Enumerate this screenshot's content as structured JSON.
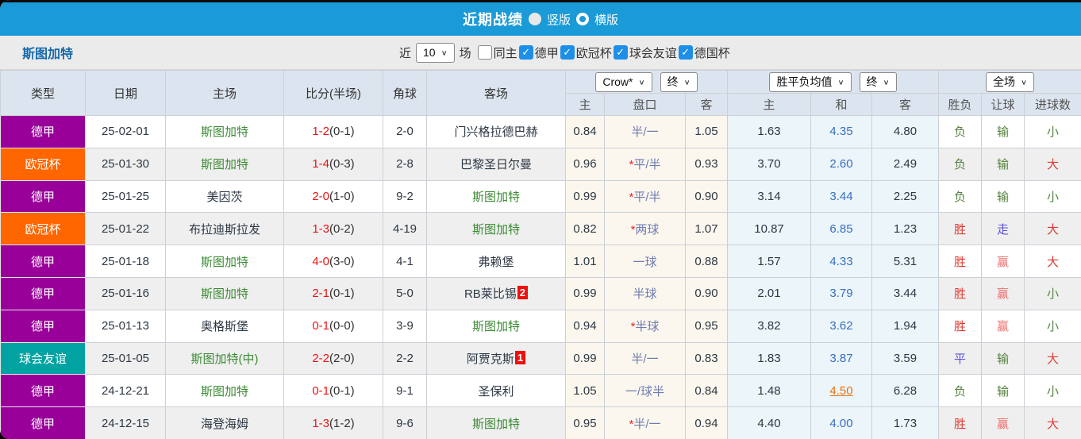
{
  "icons": {
    "chevron_down": "∨",
    "check": "✓"
  },
  "colors": {
    "topbar": "#1a9ad6",
    "league": {
      "德甲": "#990099",
      "欧冠杯": "#ff6600",
      "球会友谊": "#00a2a2"
    }
  },
  "titlebar": {
    "title": "近期战绩",
    "vertical_label": "竖版",
    "horizontal_label": "横版"
  },
  "filterbar": {
    "team": "斯图加特",
    "recent_label": "近",
    "recent_value": "10",
    "games_label": "场",
    "same_home_label": "同主",
    "same_home_checked": false,
    "league_filters": [
      {
        "label": "德甲",
        "checked": true
      },
      {
        "label": "欧冠杯",
        "checked": true
      },
      {
        "label": "球会友谊",
        "checked": true
      },
      {
        "label": "德国杯",
        "checked": true
      }
    ]
  },
  "table": {
    "static_headers": [
      "类型",
      "日期",
      "主场",
      "比分(半场)",
      "角球",
      "客场"
    ],
    "odds_source_select": "Crow*",
    "odds_final_select": "终",
    "avg_select": "胜平负均值",
    "avg_final_select": "终",
    "scope_select": "全场",
    "sub_headers": [
      "主",
      "盘口",
      "客",
      "主",
      "和",
      "客",
      "胜负",
      "让球",
      "进球数"
    ],
    "rows": [
      {
        "league": "德甲",
        "date": "25-02-01",
        "home": "斯图加特",
        "home_hl": true,
        "ft": "1-2",
        "ht": "(0-1)",
        "corners": "2-0",
        "away": "门兴格拉德巴赫",
        "away_hl": false,
        "away_badge": "",
        "odds_home": "0.84",
        "handicap_star": false,
        "handicap": "半/一",
        "odds_away": "1.05",
        "avg_home": "1.63",
        "avg_draw": "4.35",
        "avg_away": "4.80",
        "avg_draw_link": false,
        "result": "负",
        "let_result": "输",
        "goals": "小"
      },
      {
        "league": "欧冠杯",
        "date": "25-01-30",
        "home": "斯图加特",
        "home_hl": true,
        "ft": "1-4",
        "ht": "(0-3)",
        "corners": "2-8",
        "away": "巴黎圣日尔曼",
        "away_hl": false,
        "away_badge": "",
        "odds_home": "0.96",
        "handicap_star": true,
        "handicap": "平/半",
        "odds_away": "0.93",
        "avg_home": "3.70",
        "avg_draw": "2.60",
        "avg_away": "2.49",
        "avg_draw_link": false,
        "result": "负",
        "let_result": "输",
        "goals": "大"
      },
      {
        "league": "德甲",
        "date": "25-01-25",
        "home": "美因茨",
        "home_hl": false,
        "ft": "2-0",
        "ht": "(1-0)",
        "corners": "9-2",
        "away": "斯图加特",
        "away_hl": true,
        "away_badge": "",
        "odds_home": "0.99",
        "handicap_star": true,
        "handicap": "平/半",
        "odds_away": "0.90",
        "avg_home": "3.14",
        "avg_draw": "3.44",
        "avg_away": "2.25",
        "avg_draw_link": false,
        "result": "负",
        "let_result": "输",
        "goals": "小"
      },
      {
        "league": "欧冠杯",
        "date": "25-01-22",
        "home": "布拉迪斯拉发",
        "home_hl": false,
        "ft": "1-3",
        "ht": "(0-2)",
        "corners": "4-19",
        "away": "斯图加特",
        "away_hl": true,
        "away_badge": "",
        "odds_home": "0.82",
        "handicap_star": true,
        "handicap": "两球",
        "odds_away": "1.07",
        "avg_home": "10.87",
        "avg_draw": "6.85",
        "avg_away": "1.23",
        "avg_draw_link": false,
        "result": "胜",
        "let_result": "走",
        "goals": "大"
      },
      {
        "league": "德甲",
        "date": "25-01-18",
        "home": "斯图加特",
        "home_hl": true,
        "ft": "4-0",
        "ht": "(3-0)",
        "corners": "4-1",
        "away": "弗赖堡",
        "away_hl": false,
        "away_badge": "",
        "odds_home": "1.01",
        "handicap_star": false,
        "handicap": "一球",
        "odds_away": "0.88",
        "avg_home": "1.57",
        "avg_draw": "4.33",
        "avg_away": "5.31",
        "avg_draw_link": false,
        "result": "胜",
        "let_result": "赢",
        "goals": "大"
      },
      {
        "league": "德甲",
        "date": "25-01-16",
        "home": "斯图加特",
        "home_hl": true,
        "ft": "2-1",
        "ht": "(0-1)",
        "corners": "5-0",
        "away": "RB莱比锡",
        "away_hl": false,
        "away_badge": "2",
        "odds_home": "0.99",
        "handicap_star": false,
        "handicap": "半球",
        "odds_away": "0.90",
        "avg_home": "2.01",
        "avg_draw": "3.79",
        "avg_away": "3.44",
        "avg_draw_link": false,
        "result": "胜",
        "let_result": "赢",
        "goals": "小"
      },
      {
        "league": "德甲",
        "date": "25-01-13",
        "home": "奥格斯堡",
        "home_hl": false,
        "ft": "0-1",
        "ht": "(0-0)",
        "corners": "3-9",
        "away": "斯图加特",
        "away_hl": true,
        "away_badge": "",
        "odds_home": "0.94",
        "handicap_star": true,
        "handicap": "半球",
        "odds_away": "0.95",
        "avg_home": "3.82",
        "avg_draw": "3.62",
        "avg_away": "1.94",
        "avg_draw_link": false,
        "result": "胜",
        "let_result": "赢",
        "goals": "小"
      },
      {
        "league": "球会友谊",
        "date": "25-01-05",
        "home": "斯图加特(中)",
        "home_hl": true,
        "ft": "2-2",
        "ht": "(2-0)",
        "corners": "2-2",
        "away": "阿贾克斯",
        "away_hl": false,
        "away_badge": "1",
        "odds_home": "0.99",
        "handicap_star": false,
        "handicap": "半/一",
        "odds_away": "0.83",
        "avg_home": "1.83",
        "avg_draw": "3.87",
        "avg_away": "3.59",
        "avg_draw_link": false,
        "result": "平",
        "let_result": "输",
        "goals": "大"
      },
      {
        "league": "德甲",
        "date": "24-12-21",
        "home": "斯图加特",
        "home_hl": true,
        "ft": "0-1",
        "ht": "(0-1)",
        "corners": "9-1",
        "away": "圣保利",
        "away_hl": false,
        "away_badge": "",
        "odds_home": "1.05",
        "handicap_star": false,
        "handicap": "一/球半",
        "odds_away": "0.84",
        "avg_home": "1.48",
        "avg_draw": "4.50",
        "avg_away": "6.28",
        "avg_draw_link": true,
        "result": "负",
        "let_result": "输",
        "goals": "小"
      },
      {
        "league": "德甲",
        "date": "24-12-15",
        "home": "海登海姆",
        "home_hl": false,
        "ft": "1-3",
        "ht": "(1-2)",
        "corners": "9-6",
        "away": "斯图加特",
        "away_hl": true,
        "away_badge": "",
        "odds_home": "0.95",
        "handicap_star": true,
        "handicap": "半/一",
        "odds_away": "0.94",
        "avg_home": "4.40",
        "avg_draw": "4.00",
        "avg_away": "1.73",
        "avg_draw_link": false,
        "result": "胜",
        "let_result": "赢",
        "goals": "大"
      }
    ]
  }
}
